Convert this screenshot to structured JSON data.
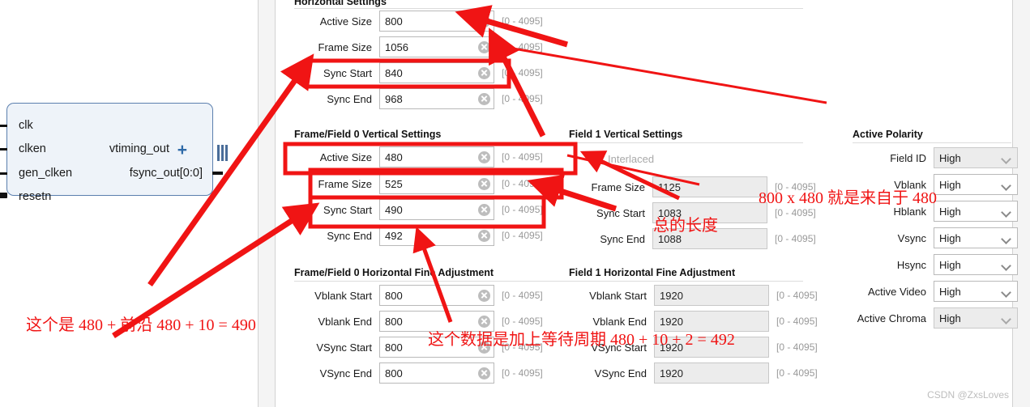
{
  "ip_symbol": {
    "inputs": [
      "clk",
      "clken",
      "gen_clken",
      "resetn"
    ],
    "outputs": [
      "vtiming_out",
      "fsync_out[0:0]"
    ],
    "expand_glyph": "+"
  },
  "groups": {
    "horizontal": {
      "title": "Horizontal Settings",
      "rows": [
        {
          "label": "Active Size",
          "value": "800",
          "range": "[0 - 4095]"
        },
        {
          "label": "Frame Size",
          "value": "1056",
          "range": "[0 - 4095]"
        },
        {
          "label": "Sync Start",
          "value": "840",
          "range": "[0 - 4095]"
        },
        {
          "label": "Sync End",
          "value": "968",
          "range": "[0 - 4095]"
        }
      ]
    },
    "vertical0": {
      "title": "Frame/Field 0 Vertical Settings",
      "rows": [
        {
          "label": "Active Size",
          "value": "480",
          "range": "[0 - 4095]"
        },
        {
          "label": "Frame Size",
          "value": "525",
          "range": "[0 - 4095]"
        },
        {
          "label": "Sync Start",
          "value": "490",
          "range": "[0 - 4095]"
        },
        {
          "label": "Sync End",
          "value": "492",
          "range": "[0 - 4095]"
        }
      ]
    },
    "vertical1": {
      "title": "Field 1 Vertical Settings",
      "interlaced_label": "Interlaced",
      "interlaced_checked": false,
      "rows": [
        {
          "label": "Frame Size",
          "value": "1125",
          "range": "[0 - 4095]"
        },
        {
          "label": "Sync Start",
          "value": "1083",
          "range": "[0 - 4095]"
        },
        {
          "label": "Sync End",
          "value": "1088",
          "range": "[0 - 4095]"
        }
      ]
    },
    "hfine0": {
      "title": "Frame/Field 0 Horizontal Fine Adjustment",
      "rows": [
        {
          "label": "Vblank Start",
          "value": "800",
          "range": "[0 - 4095]"
        },
        {
          "label": "Vblank End",
          "value": "800",
          "range": "[0 - 4095]"
        },
        {
          "label": "VSync Start",
          "value": "800",
          "range": "[0 - 4095]"
        },
        {
          "label": "VSync End",
          "value": "800",
          "range": "[0 - 4095]"
        }
      ]
    },
    "hfine1": {
      "title": "Field 1 Horizontal Fine Adjustment",
      "rows": [
        {
          "label": "Vblank Start",
          "value": "1920",
          "range": "[0 - 4095]"
        },
        {
          "label": "Vblank End",
          "value": "1920",
          "range": "[0 - 4095]"
        },
        {
          "label": "VSync Start",
          "value": "1920",
          "range": "[0 - 4095]"
        },
        {
          "label": "VSync End",
          "value": "1920",
          "range": "[0 - 4095]"
        }
      ]
    },
    "polarity": {
      "title": "Active Polarity",
      "rows": [
        {
          "label": "Field ID",
          "value": "High",
          "disabled": true
        },
        {
          "label": "Vblank",
          "value": "High",
          "disabled": false
        },
        {
          "label": "Hblank",
          "value": "High",
          "disabled": false
        },
        {
          "label": "Vsync",
          "value": "High",
          "disabled": false
        },
        {
          "label": "Hsync",
          "value": "High",
          "disabled": false
        },
        {
          "label": "Active Video",
          "value": "High",
          "disabled": false
        },
        {
          "label": "Active Chroma",
          "value": "High",
          "disabled": true
        }
      ]
    }
  },
  "annotations": {
    "note_490": "这个是 480 + 前沿 480 + 10 = 490",
    "note_492": "这个数据是加上等待周期 480 + 10 + 2 = 492",
    "note_800x480": "800 x 480  就是来自于 480",
    "note_total_length": "总的长度",
    "accent_color": "#f01414"
  },
  "watermark": "CSDN @ZxsLoves"
}
